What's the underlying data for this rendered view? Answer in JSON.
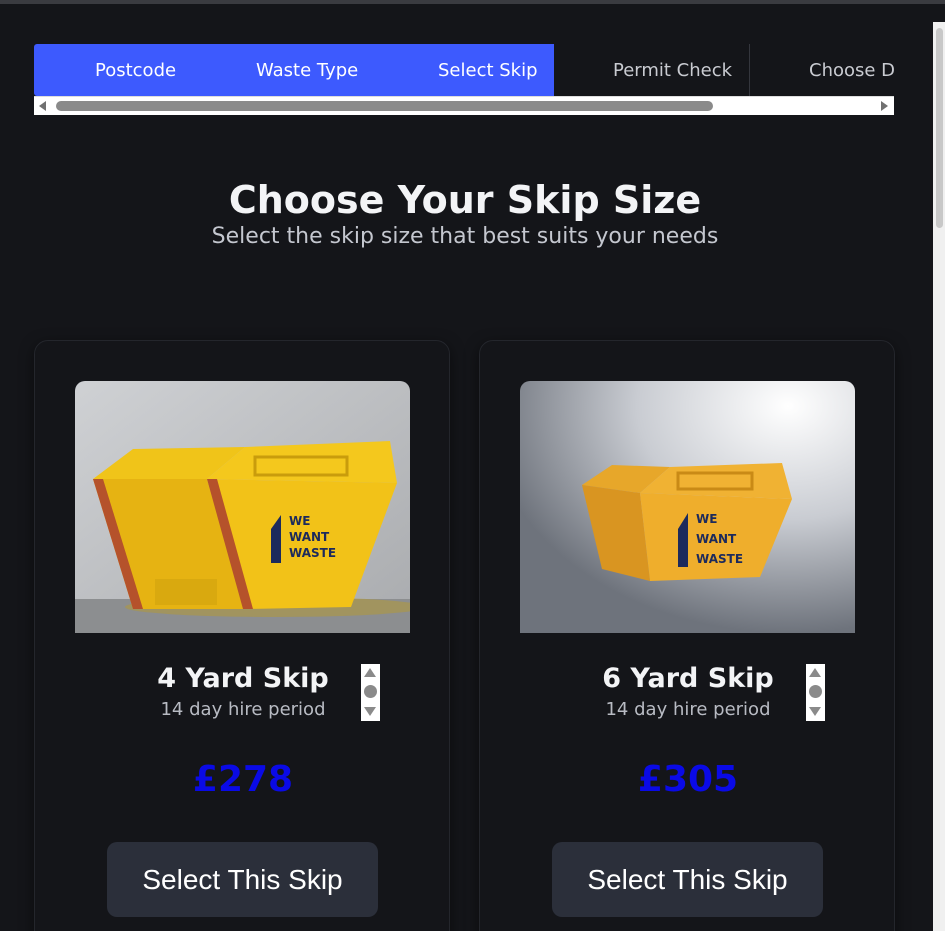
{
  "stepper": {
    "steps": [
      {
        "label": "Postcode",
        "state": "completed"
      },
      {
        "label": "Waste Type",
        "state": "completed"
      },
      {
        "label": "Select Skip",
        "state": "current"
      },
      {
        "label": "Permit Check",
        "state": "upcoming"
      },
      {
        "label": "Choose D",
        "state": "upcoming"
      }
    ],
    "active_color": "#3d5afe"
  },
  "page": {
    "title": "Choose Your Skip Size",
    "subtitle": "Select the skip size that best suits your needs"
  },
  "skips": [
    {
      "image_icon": "yellow-skip-photo",
      "logo_text": [
        "WE",
        "WANT",
        "WASTE"
      ],
      "name": "4 Yard Skip",
      "hire_period": "14 day hire period",
      "price": "£278",
      "button_label": "Select This Skip"
    },
    {
      "image_icon": "yellow-skip-photo",
      "logo_text": [
        "WE",
        "WANT",
        "WASTE"
      ],
      "name": "6 Yard Skip",
      "hire_period": "14 day hire period",
      "price": "£305",
      "button_label": "Select This Skip"
    }
  ],
  "colors": {
    "background": "#141519",
    "price": "#0a0ae6",
    "button": "#2b2f3a",
    "skip_yellow": "#f2c300"
  }
}
